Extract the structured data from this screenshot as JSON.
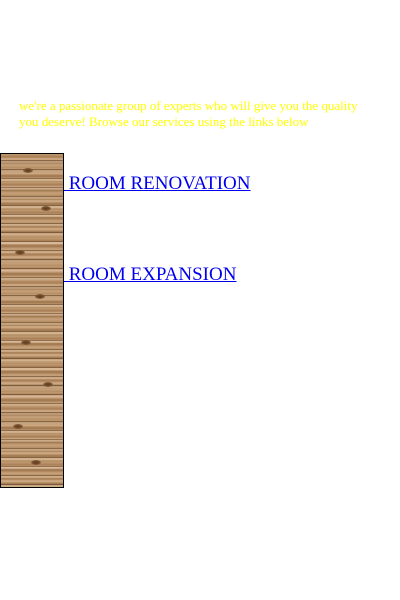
{
  "intro": {
    "text": "we're a passionate group of experts who will give you the quality you deserve! Browse our services using the links below"
  },
  "links": [
    {
      "label": " ROOM RENOVATION"
    },
    {
      "label": " ROOM EXPANSION"
    }
  ],
  "colors": {
    "intro_text": "#ffff00",
    "link": "#0000ee",
    "panel_border": "#000000"
  },
  "images": {
    "side_panel": "wood-texture-image"
  }
}
